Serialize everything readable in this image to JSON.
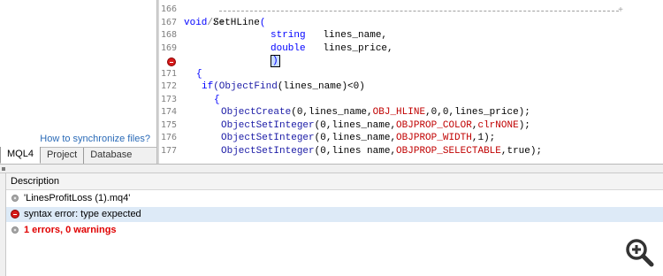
{
  "navigator": {
    "sync_link": "How to synchronize files?",
    "tabs": [
      {
        "label": "MQL4",
        "active": true
      },
      {
        "label": "Project",
        "active": false
      },
      {
        "label": "Database",
        "active": false
      }
    ]
  },
  "editor": {
    "line_numbers": [
      "166",
      "167",
      "168",
      "169",
      "",
      "171",
      "172",
      "173",
      "174",
      "175",
      "176",
      "177"
    ],
    "lines": {
      "l166": "//+",
      "l166_end": "+",
      "l167_kw": "void",
      "l167_rest": " SetHLine",
      "l167_paren": "(",
      "l168_type": "string",
      "l168_name": "   lines_name,",
      "l169_type": "double",
      "l169_name": "   lines_price,",
      "l170_paren": ")",
      "l171": "{",
      "l172_kw": "if",
      "l172_fn": "(ObjectFind",
      "l172_rest": "(lines_name)<0)",
      "l173": "{",
      "l174_fn": "ObjectCreate",
      "l174_a": "(0,lines_name,",
      "l174_const": "OBJ_HLINE",
      "l174_b": ",0,0,lines_price);",
      "l175_fn": "ObjectSetInteger",
      "l175_a": "(0,lines_name,",
      "l175_const": "OBJPROP_COLOR",
      "l175_b": ",",
      "l175_const2": "clrNONE",
      "l175_c": ");",
      "l176_fn": "ObjectSetInteger",
      "l176_a": "(0,lines_name,",
      "l176_const": "OBJPROP_WIDTH",
      "l176_b": ",1);",
      "l177_fn": "ObjectSetInteger",
      "l177_a": "(0,lines name,",
      "l177_const": "OBJPROP_SELECTABLE",
      "l177_b": ",true);"
    },
    "error_marker_line": "170"
  },
  "errors_panel": {
    "column_header": "Description",
    "rows": [
      {
        "icon": "info-dot-icon",
        "text": "'LinesProfitLoss (1).mq4'",
        "style": "normal"
      },
      {
        "icon": "error-stop-icon",
        "text": "syntax error: type expected",
        "style": "normal",
        "selected": true
      },
      {
        "icon": "info-dot-icon",
        "text": "1 errors, 0 warnings",
        "style": "bold-red"
      }
    ]
  },
  "colors": {
    "keyword": "#0000ff",
    "constant": "#c00000",
    "comment": "#808080",
    "error": "#d61a1a",
    "link": "#2a6ab7",
    "selection": "#ddeaf7"
  },
  "overlay": {
    "icon": "zoom-in-icon"
  }
}
